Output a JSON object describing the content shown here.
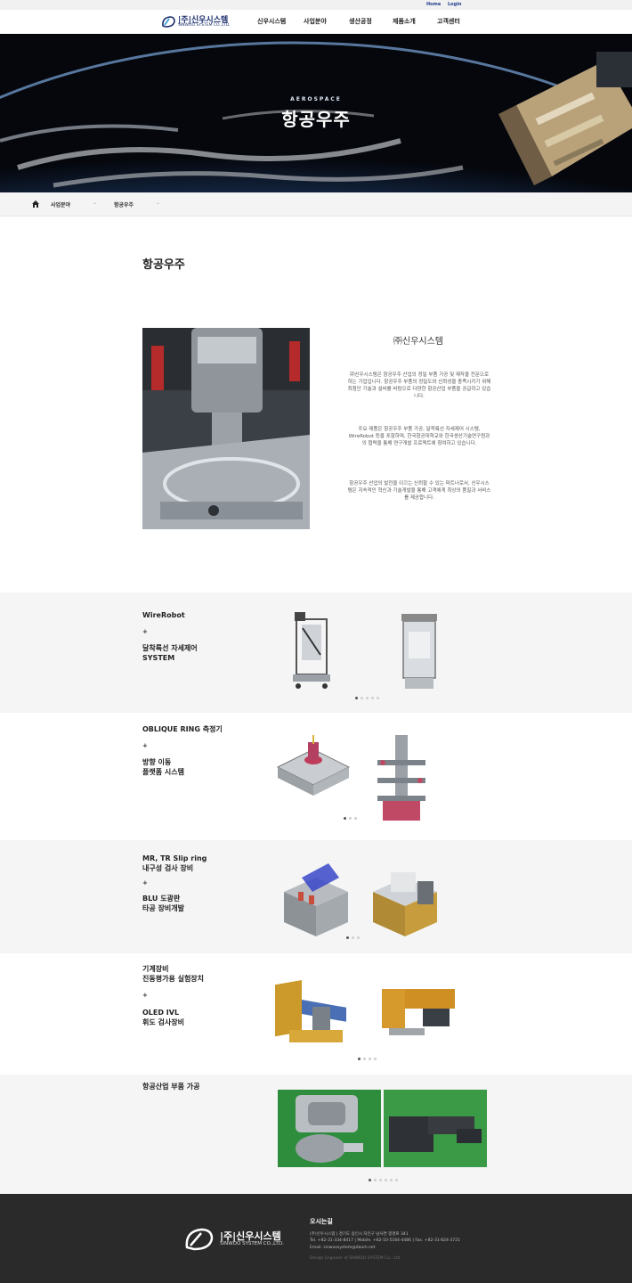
{
  "topbar": {
    "home": "Home",
    "login": "Login"
  },
  "header": {
    "logo_kr": "|주|신우시스템",
    "logo_en": "SINWOO SYSTEM CO.,LTD.",
    "nav": [
      "신우시스템",
      "사업분야",
      "생산공정",
      "제품소개",
      "고객센터"
    ]
  },
  "hero": {
    "subtitle": "AEROSPACE",
    "title": "항공우주"
  },
  "breadcrumb": {
    "level1": "사업분야",
    "level2": "항공우주"
  },
  "intro": {
    "page_title": "항공우주",
    "company": "㈜신우시스템",
    "paragraphs": [
      "㈜신우시스템은 항공우주 산업의 정밀 부품 가공 및 제작을 전문으로 하는 기업입니다. 항공우주 부품의 정밀도와 신뢰성을 충족시키기 위해 최첨단 기술과 설비를 바탕으로 다양한 항공산업 부품을 공급하고 있습니다.",
      "주요 제품은 항공우주 부품 가공, 달착륙선 자세제어 시스템, WireRobot 등을 포함하며, 한국항공대학교와 한국생산기술연구원과의 협력을 통해 연구개발 프로젝트에 참여하고 있습니다.",
      "항공우주 산업의 발전을 이끄는 신뢰할 수 있는 파트너로서, 신우시스템은 지속적인 혁신과 기술개발을 통해 고객에게 최상의 품질과 서비스를 제공합니다."
    ]
  },
  "sections": [
    {
      "title": "WireRobot",
      "plus": "+",
      "subtitle": "달착륙선 자세제어\nSYSTEM",
      "dots": 5,
      "active": 0
    },
    {
      "title": "OBLIQUE RING 측정기",
      "plus": "+",
      "subtitle": "방향 이동\n플랫폼 시스템",
      "dots": 3,
      "active": 0
    },
    {
      "title": "MR, TR Slip ring\n내구성 검사 장비",
      "plus": "+",
      "subtitle": "BLU 도광판\n타공 장비개발",
      "dots": 3,
      "active": 0
    },
    {
      "title": "기계장비\n진동평가용 실험장치",
      "plus": "+",
      "subtitle": "OLED IVL\n휘도 검사장비",
      "dots": 4,
      "active": 0
    },
    {
      "title": "항공산업 부품 가공",
      "plus": "",
      "subtitle": "",
      "dots": 6,
      "active": 0
    }
  ],
  "footer": {
    "logo_kr": "|주|신우시스템",
    "logo_en": "SINWOO SYSTEM CO.,LTD.",
    "title": "오시는길",
    "line1": "(주)신우시스템   |   경기도 용인시 처인구 남사면 봉명로 341",
    "line2": "Tel. +82-31-334-8417   |   Mobile. +82-10-5164-4486   |   Fax. +82-31-824-3721",
    "line3": "Email. sinwoosystem@daum.net",
    "copyright": "Design Engineer of SINWOO SYSTEM Co., Ltd."
  },
  "colors": {
    "brand": "#1c2f6e",
    "footer_bg": "#2a2a2a",
    "section_grey": "#f5f5f5"
  }
}
